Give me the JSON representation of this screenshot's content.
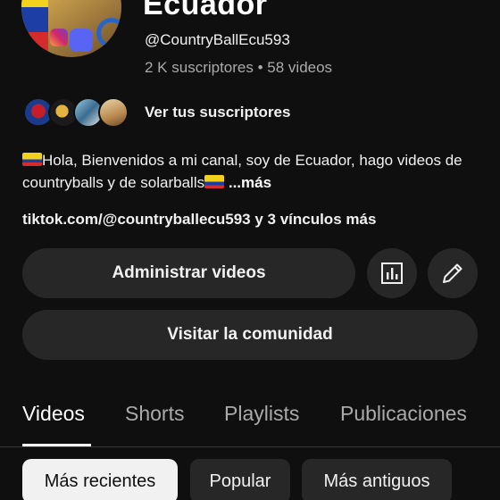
{
  "channel": {
    "name": "Ecuador",
    "handle": "@CountryBallEcu593",
    "stats": "2 K suscriptores • 58 videos"
  },
  "subscribers": {
    "link_label": "Ver tus suscriptores"
  },
  "description": {
    "line": "Hola, Bienvenidos a mi canal, soy de Ecuador, hago videos de countryballs y de solarballs",
    "more_label": "...más"
  },
  "links": {
    "primary": "tiktok.com/@countryballecu593",
    "rest": " y 3 vínculos más"
  },
  "actions": {
    "manage_label": "Administrar videos",
    "community_label": "Visitar la comunidad",
    "analytics_icon": "analytics-icon",
    "edit_icon": "pencil-icon"
  },
  "tabs": [
    {
      "label": "Videos",
      "active": true
    },
    {
      "label": "Shorts",
      "active": false
    },
    {
      "label": "Playlists",
      "active": false
    },
    {
      "label": "Publicaciones",
      "active": false
    }
  ],
  "chips": [
    {
      "label": "Más recientes",
      "selected": true
    },
    {
      "label": "Popular",
      "selected": false
    },
    {
      "label": "Más antiguos",
      "selected": false
    }
  ],
  "colors": {
    "background": "#0f0f0f",
    "button": "#272727",
    "text": "#f1f1f1",
    "secondary_text": "#aaaaaa",
    "selected_chip": "#f1f1f1"
  }
}
